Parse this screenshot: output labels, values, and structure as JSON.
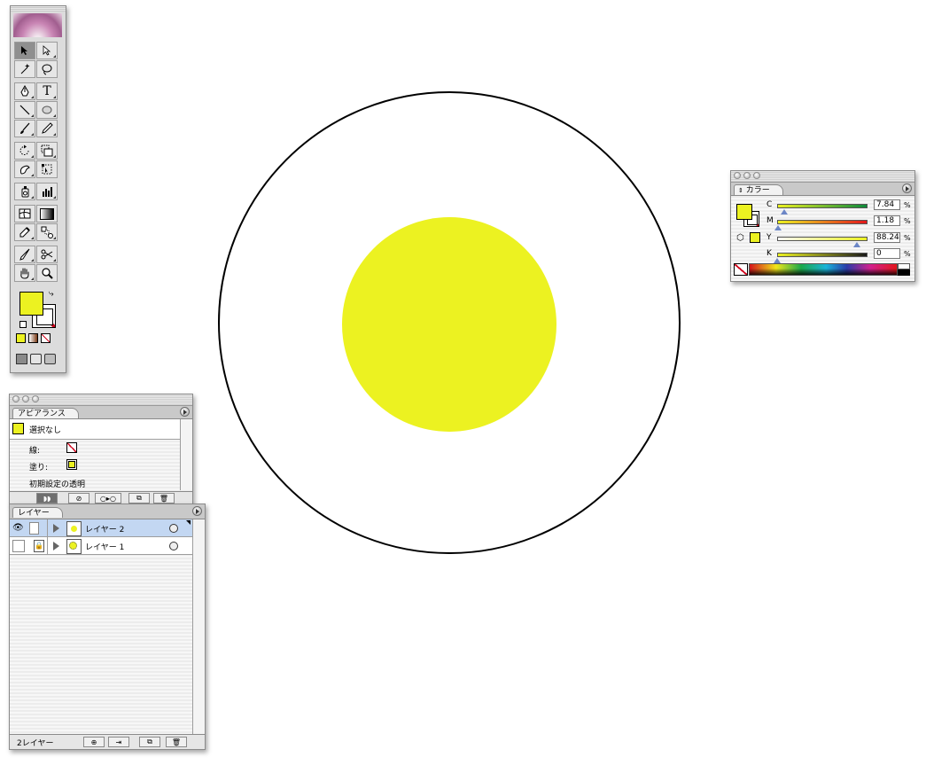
{
  "canvas": {
    "outer_circle": {
      "fill": "#ffffff",
      "stroke": "#000000"
    },
    "inner_circle": {
      "fill": "#ecf221"
    }
  },
  "tools": {
    "items": [
      "selection-arrow-icon",
      "direct-selection-icon",
      "magic-wand-icon",
      "lasso-icon",
      "pen-icon",
      "type-icon",
      "line-icon",
      "ellipse-icon",
      "paintbrush-icon",
      "pencil-icon",
      "rotate-icon",
      "scale-icon",
      "warp-icon",
      "free-transform-icon",
      "symbol-sprayer-icon",
      "graph-icon",
      "mesh-icon",
      "gradient-icon",
      "eyedropper-icon",
      "blend-icon",
      "slice-icon",
      "scissors-icon",
      "hand-icon",
      "zoom-icon"
    ],
    "type_glyph": "T",
    "fill_color": "#ecf221"
  },
  "appearance": {
    "tab": "アピアランス",
    "selection": "選択なし",
    "stroke_label": "線:",
    "fill_label": "塗り:",
    "transparency": "初期設定の透明"
  },
  "layers": {
    "tab": "レイヤー",
    "rows": [
      {
        "name": "レイヤー 2",
        "selected": true
      },
      {
        "name": "レイヤー 1",
        "selected": false
      }
    ],
    "footer_count": "2レイヤー"
  },
  "color": {
    "tab": "カラー",
    "channels": [
      {
        "label": "C",
        "value": "7.84",
        "unit": "%",
        "level": 0.0784
      },
      {
        "label": "M",
        "value": "1.18",
        "unit": "%",
        "level": 0.0118
      },
      {
        "label": "Y",
        "value": "88.24",
        "unit": "%",
        "level": 0.8824
      },
      {
        "label": "K",
        "value": "0",
        "unit": "%",
        "level": 0
      }
    ],
    "fill_color": "#ecf221"
  }
}
